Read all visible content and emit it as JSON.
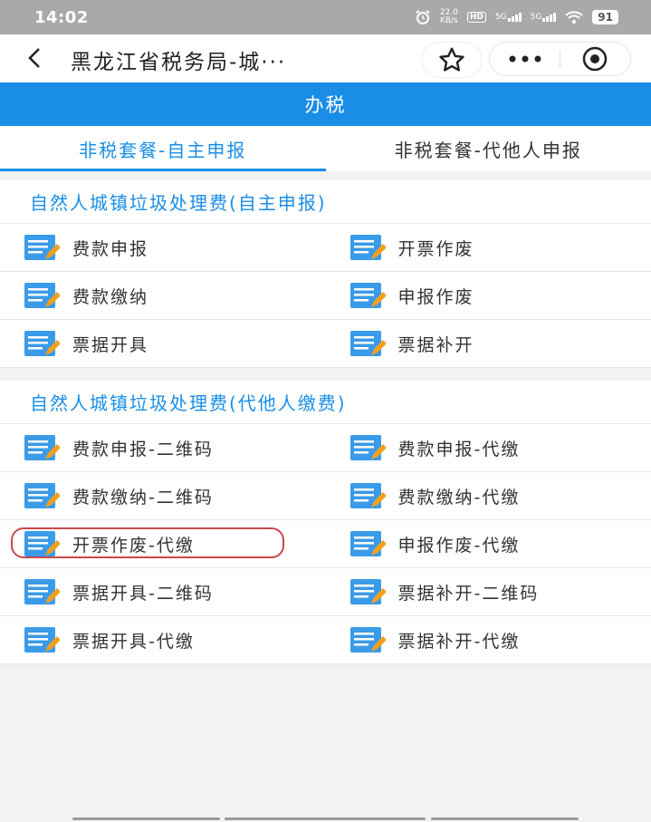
{
  "status_bar": {
    "time": "14:02",
    "speed_value": "22.0",
    "speed_unit": "KB/s",
    "hd": "HD",
    "net1": "5G",
    "net2": "5G",
    "battery": "91"
  },
  "nav": {
    "title": "黑龙江省税务局-城···"
  },
  "header": {
    "title": "办税"
  },
  "tabs": [
    {
      "label": "非税套餐-自主申报",
      "active": true
    },
    {
      "label": "非税套餐-代他人申报",
      "active": false
    }
  ],
  "sections": [
    {
      "title": "自然人城镇垃圾处理费(自主申报)",
      "rows": [
        [
          "费款申报",
          "开票作废"
        ],
        [
          "费款缴纳",
          "申报作废"
        ],
        [
          "票据开具",
          "票据补开"
        ]
      ]
    },
    {
      "title": "自然人城镇垃圾处理费(代他人缴费)",
      "rows": [
        [
          "费款申报-二维码",
          "费款申报-代缴"
        ],
        [
          "费款缴纳-二维码",
          "费款缴纳-代缴"
        ],
        [
          "开票作废-代缴",
          "申报作废-代缴"
        ],
        [
          "票据开具-二维码",
          "票据补开-二维码"
        ],
        [
          "票据开具-代缴",
          "票据补开-代缴"
        ]
      ]
    }
  ],
  "colors": {
    "accent": "#1a8ee6",
    "highlight": "#c8484d",
    "icon_blue": "#3a9be8",
    "icon_pencil": "#f0a020"
  },
  "icons": [
    "back-arrow-icon",
    "star-icon",
    "more-icon",
    "record-icon",
    "document-edit-icon"
  ]
}
